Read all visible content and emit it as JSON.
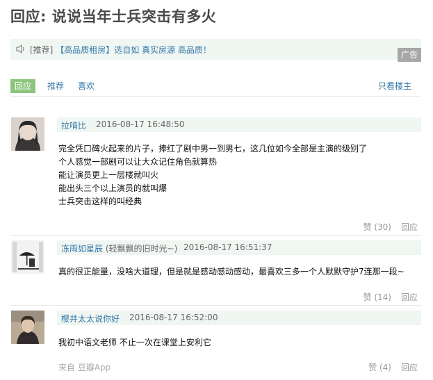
{
  "page": {
    "title": "回应: 说说当年士兵突击有多火"
  },
  "ad": {
    "tag": "[推荐]",
    "text": "【高品质租房】选自如 真实房源 高品质！",
    "badge": "广告"
  },
  "tabs": {
    "active": "回应",
    "recommend": "推荐",
    "like": "喜欢",
    "owner_only": "只看楼主"
  },
  "comments": [
    {
      "user": "拉啃比",
      "signature": "",
      "time": "2016-08-17 16:48:50",
      "lines": [
        "完全凭口碑火起来的片子，捧红了剧中男一到男七，这几位如今全部是主演的级别了",
        "个人感觉一部剧可以让大众记住角色就算热",
        "能让演员更上一层楼就叫火",
        "能出头三个以上演员的就叫爆",
        "士兵突击这样的叫经典"
      ],
      "like": "赞 (30)",
      "reply": "回应",
      "source": ""
    },
    {
      "user": "冻雨如星辰",
      "signature": "(轻飘飘的旧时光~)",
      "time": "2016-08-17 16:51:37",
      "lines": [
        "真的很正能量，没啥大道理，但是就是感动感动感动，最喜欢三多一个人默默守护7连那一段~"
      ],
      "like": "赞 (14)",
      "reply": "回应",
      "source": ""
    },
    {
      "user": "樱井太太说你好",
      "signature": "",
      "time": "2016-08-17 16:52:00",
      "lines": [
        "我初中语文老师 不止一次在课堂上安利它"
      ],
      "like": "赞 (4)",
      "reply": "回应",
      "source": "来自 豆瓣App"
    }
  ],
  "colors": {
    "link": "#3377aa",
    "meta_bg": "#f0f6f2",
    "active_tab": "#8cc67d",
    "badge_bg": "#a7a7a7"
  },
  "icons": {
    "speaker": "speaker-icon"
  }
}
